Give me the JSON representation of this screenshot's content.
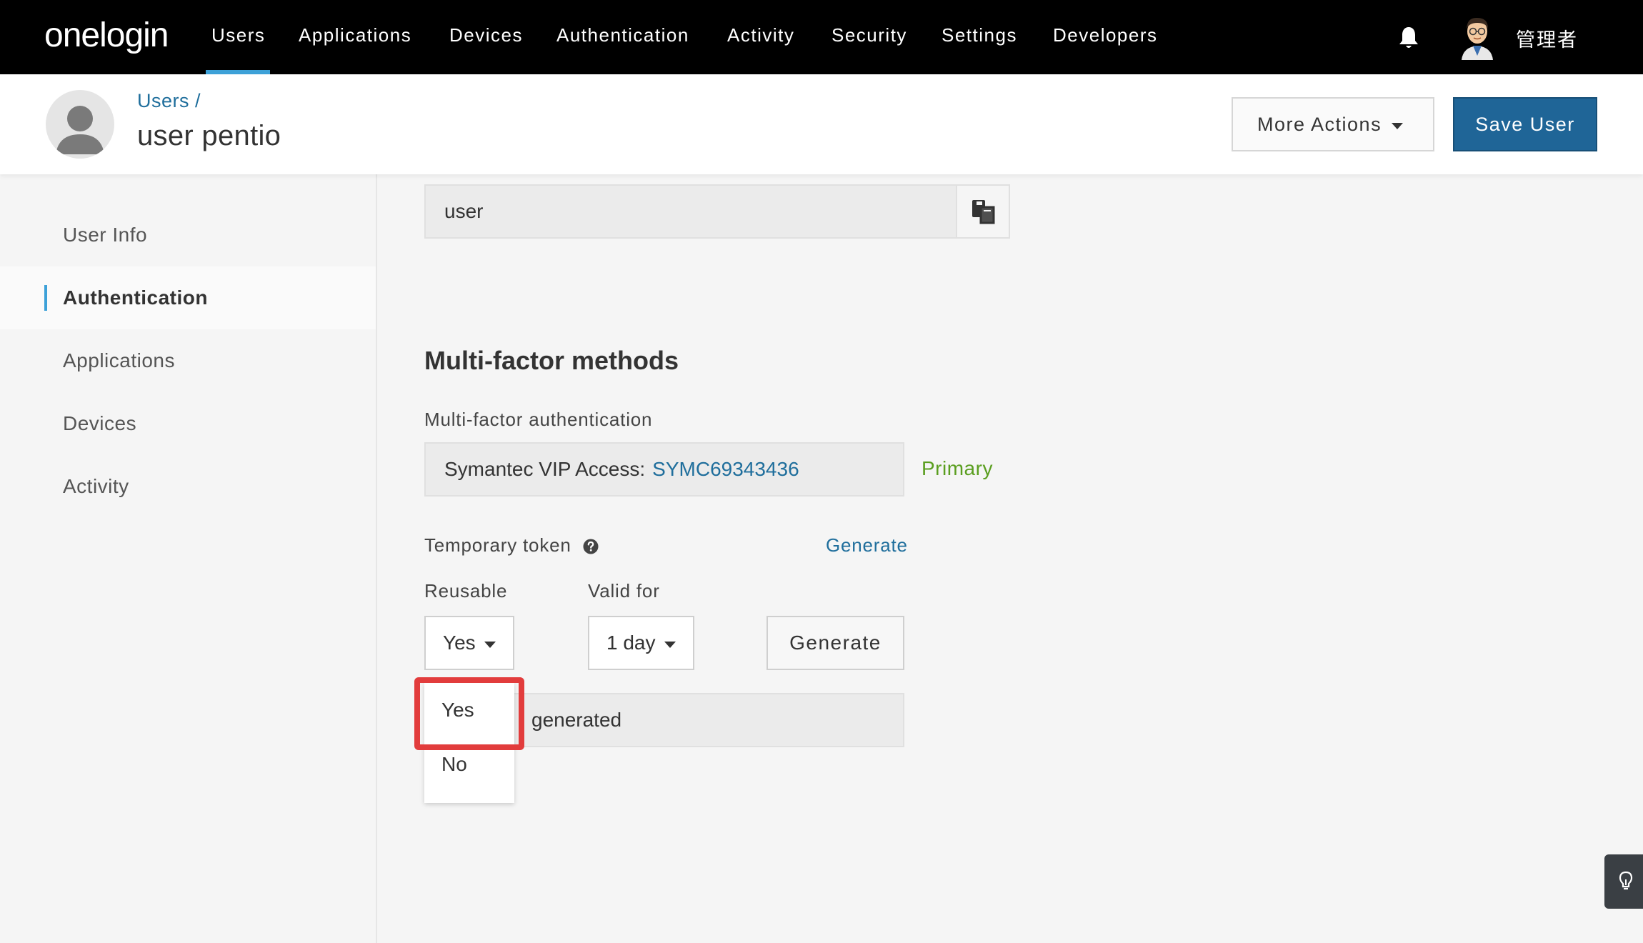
{
  "topnav": {
    "logo": "onelogin",
    "items": [
      "Users",
      "Applications",
      "Devices",
      "Authentication",
      "Activity",
      "Security",
      "Settings",
      "Developers"
    ],
    "active_item": "Users",
    "user_name": "管理者",
    "accent_color": "#3da1d8"
  },
  "header": {
    "breadcrumb": "Users /",
    "title": "user pentio",
    "more_actions_label": "More Actions",
    "save_label": "Save User",
    "save_color": "#1f6597"
  },
  "sidebar": {
    "items": [
      "User Info",
      "Authentication",
      "Applications",
      "Devices",
      "Activity"
    ],
    "active_item": "Authentication"
  },
  "main": {
    "username_value": "user",
    "mfa_section_title": "Multi-factor methods",
    "mfa_label": "Multi-factor authentication",
    "mfa_device_name": "Symantec VIP Access:",
    "mfa_device_id": "SYMC69343436",
    "mfa_primary_tag": "Primary",
    "temp_token_label": "Temporary token",
    "temp_token_generate_link": "Generate",
    "reusable_label": "Reusable",
    "reusable_value": "Yes",
    "valid_for_label": "Valid for",
    "valid_for_value": "1 day",
    "generate_button": "Generate",
    "token_status": "generated"
  },
  "dropdown": {
    "options": [
      "Yes",
      "No"
    ],
    "highlighted": "Yes",
    "highlight_color": "#e23c3c"
  },
  "icons": {
    "bell": "bell-icon",
    "copy": "copy-icon",
    "help": "question-circle-icon",
    "lightbulb": "lightbulb-icon",
    "user_placeholder": "user-placeholder-icon"
  }
}
